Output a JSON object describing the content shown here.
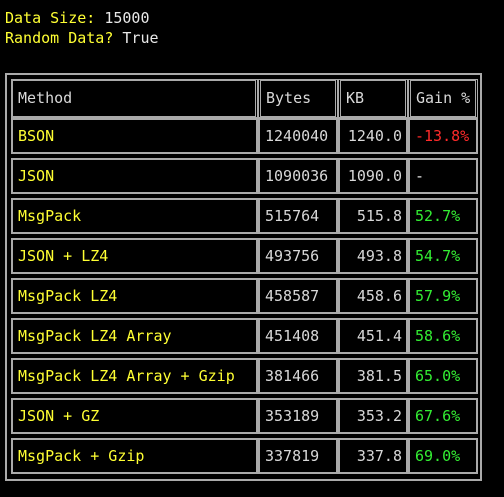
{
  "info": {
    "data_size_label": "Data Size:",
    "data_size_value": "15000",
    "random_label": "Random Data?",
    "random_value": "True"
  },
  "table": {
    "headers": {
      "method": "Method",
      "bytes": "Bytes",
      "kb": "KB",
      "gain": "Gain %"
    },
    "rows": [
      {
        "method": "BSON",
        "bytes": "1240040",
        "kb": "1240.0",
        "gain": "-13.8%",
        "gain_color": "#ff2a2a"
      },
      {
        "method": "JSON",
        "bytes": "1090036",
        "kb": "1090.0",
        "gain": "-",
        "gain_color": "#e8e8e8"
      },
      {
        "method": "MsgPack",
        "bytes": "515764",
        "kb": "515.8",
        "gain": "52.7%",
        "gain_color": "#33ee33"
      },
      {
        "method": "JSON + LZ4",
        "bytes": "493756",
        "kb": "493.8",
        "gain": "54.7%",
        "gain_color": "#33ee33"
      },
      {
        "method": "MsgPack LZ4",
        "bytes": "458587",
        "kb": "458.6",
        "gain": "57.9%",
        "gain_color": "#33ee33"
      },
      {
        "method": "MsgPack LZ4 Array",
        "bytes": "451408",
        "kb": "451.4",
        "gain": "58.6%",
        "gain_color": "#33ee33"
      },
      {
        "method": "MsgPack LZ4 Array + Gzip",
        "bytes": "381466",
        "kb": "381.5",
        "gain": "65.0%",
        "gain_color": "#33ee33"
      },
      {
        "method": "JSON + GZ",
        "bytes": "353189",
        "kb": "353.2",
        "gain": "67.6%",
        "gain_color": "#33ee33"
      },
      {
        "method": "MsgPack + Gzip",
        "bytes": "337819",
        "kb": "337.8",
        "gain": "69.0%",
        "gain_color": "#33ee33"
      }
    ]
  }
}
